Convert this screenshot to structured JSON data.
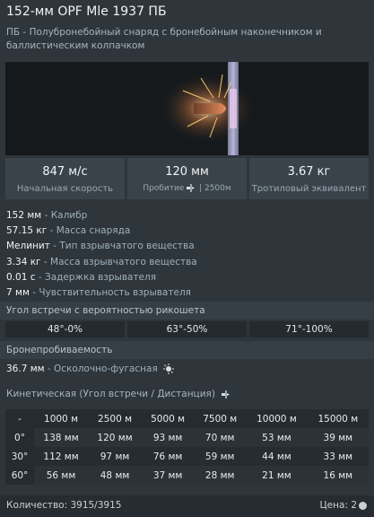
{
  "header": {
    "title": "152-мм OPF Mle 1937 ПБ",
    "subtitle": "ПБ - Полубронебойный снаряд с бронебойным наконечником и баллистическим колпачком"
  },
  "stats": {
    "velocity_value": "847 м/с",
    "velocity_label": "Начальная скорость",
    "penetration_value": "120 мм",
    "penetration_label": "Пробитие",
    "penetration_distance": "| 2500м",
    "tnt_value": "3.67 кг",
    "tnt_label": "Тротиловый эквивалент"
  },
  "props": [
    {
      "value": "152 мм",
      "label": " - Калибр"
    },
    {
      "value": "57.15 кг",
      "label": " - Масса снаряда"
    },
    {
      "value": "Мелинит",
      "label": " - Тип взрывчатого вещества"
    },
    {
      "value": "3.34 кг",
      "label": " - Масса взрывчатого вещества"
    },
    {
      "value": "0.01 с",
      "label": " - Задержка взрывателя"
    },
    {
      "value": "7 мм",
      "label": " - Чувствительность взрывателя"
    }
  ],
  "ricochet": {
    "heading": "Угол встречи с вероятностью рикошета",
    "values": [
      "48°-0%",
      "63°-50%",
      "71°-100%"
    ]
  },
  "armor": {
    "heading": "Бронепробиваемость",
    "he_value": "36.7 мм",
    "he_label": " - Осколочно-фугасная"
  },
  "kinetic": {
    "heading": "Кинетическая (Угол встречи / Дистанция)",
    "corner": "-",
    "distances": [
      "1000 м",
      "2500 м",
      "5000 м",
      "7500 м",
      "10000 м",
      "15000 м"
    ],
    "rows": [
      {
        "angle": "0°",
        "values": [
          "138 мм",
          "120 мм",
          "93 мм",
          "70 мм",
          "53 мм",
          "39 мм"
        ]
      },
      {
        "angle": "30°",
        "values": [
          "112 мм",
          "97 мм",
          "76 мм",
          "59 мм",
          "44 мм",
          "33 мм"
        ]
      },
      {
        "angle": "60°",
        "values": [
          "56 мм",
          "48 мм",
          "37 мм",
          "28 мм",
          "21 мм",
          "16 мм"
        ]
      }
    ]
  },
  "footer": {
    "quantity": "Количество: 3915/3915",
    "price": "Цена: 2"
  },
  "icons": {
    "penetration": "shell-penetration-icon",
    "he": "explosion-icon",
    "price": "coin-icon"
  }
}
